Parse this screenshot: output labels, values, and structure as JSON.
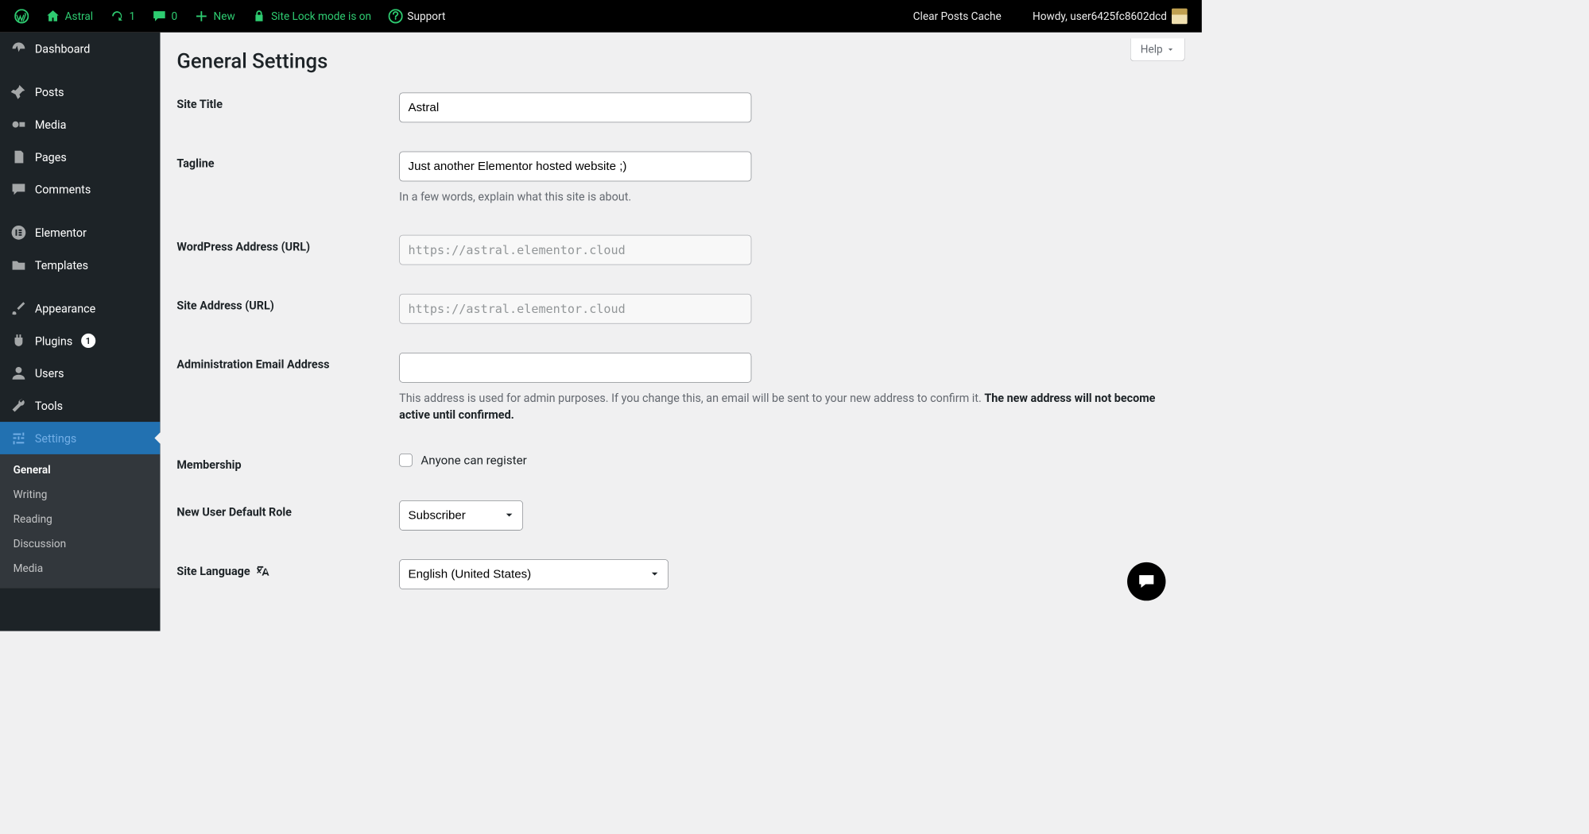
{
  "toolbar": {
    "site_name": "Astral",
    "updates_count": "1",
    "comments_count": "0",
    "new_label": "New",
    "lock_label": "Site Lock mode is on",
    "support_label": "Support",
    "clear_cache_label": "Clear Posts Cache",
    "howdy_label": "Howdy, user6425fc8602dcd"
  },
  "sidebar": {
    "items": [
      {
        "label": "Dashboard"
      },
      {
        "label": "Posts"
      },
      {
        "label": "Media"
      },
      {
        "label": "Pages"
      },
      {
        "label": "Comments"
      },
      {
        "label": "Elementor"
      },
      {
        "label": "Templates"
      },
      {
        "label": "Appearance"
      },
      {
        "label": "Plugins",
        "badge": "1"
      },
      {
        "label": "Users"
      },
      {
        "label": "Tools"
      },
      {
        "label": "Settings"
      }
    ],
    "submenu": [
      {
        "label": "General",
        "current": true
      },
      {
        "label": "Writing"
      },
      {
        "label": "Reading"
      },
      {
        "label": "Discussion"
      },
      {
        "label": "Media"
      }
    ]
  },
  "page": {
    "help_label": "Help",
    "title": "General Settings",
    "fields": {
      "site_title": {
        "label": "Site Title",
        "value": "Astral"
      },
      "tagline": {
        "label": "Tagline",
        "value": "Just another Elementor hosted website ;)",
        "description": "In a few words, explain what this site is about."
      },
      "wp_address": {
        "label": "WordPress Address (URL)",
        "value": "https://astral.elementor.cloud"
      },
      "site_address": {
        "label": "Site Address (URL)",
        "value": "https://astral.elementor.cloud"
      },
      "admin_email": {
        "label": "Administration Email Address",
        "value": "",
        "description_a": "This address is used for admin purposes. If you change this, an email will be sent to your new address to confirm it. ",
        "description_b": "The new address will not become active until confirmed."
      },
      "membership": {
        "label": "Membership",
        "checkbox_label": "Anyone can register"
      },
      "default_role": {
        "label": "New User Default Role",
        "value": "Subscriber"
      },
      "site_language": {
        "label": "Site Language",
        "value": "English (United States)"
      }
    }
  }
}
